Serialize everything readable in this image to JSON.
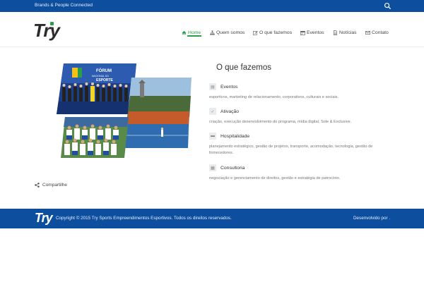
{
  "topbar": {
    "tagline": "Brands & People Connected",
    "search_icon": "search-icon"
  },
  "header": {
    "logo": "Try",
    "nav": [
      {
        "label": "Home",
        "icon": "home-icon",
        "active": true
      },
      {
        "label": "Quem somos",
        "icon": "sitemap-icon"
      },
      {
        "label": "O que fazemos",
        "icon": "edit-icon"
      },
      {
        "label": "Eventos",
        "icon": "calendar-icon"
      },
      {
        "label": "Notícias",
        "icon": "document-icon"
      },
      {
        "label": "Contato",
        "icon": "envelope-icon"
      }
    ]
  },
  "main": {
    "title": "O que fazemos",
    "services": [
      {
        "title": "Eventos",
        "icon": "table-icon",
        "desc": "esportivos, marketing de relacionamento, corporativos, culturais e sociais."
      },
      {
        "title": "Ativação",
        "icon": "check-icon",
        "desc": "criação, execução desenvolvimento do programa, mídia digital, Sole & Exclusive."
      },
      {
        "title": "Hospitalidade",
        "icon": "bed-icon",
        "desc": "planejamento estratégico, gestão de projetos, transporte, acomodação, tecnologia, gestão de fornecedores."
      },
      {
        "title": "Consultoria",
        "icon": "chart-icon",
        "desc": "negociação e gerenciamento de direitos, gestão e estratégia de patrocínio."
      }
    ],
    "collage_banner": "FÓRUM NACIONAL DO ESPORTE",
    "share_label": "Compartilhe"
  },
  "footer": {
    "logo": "Try",
    "copyright": "Copyright © 2015 Try Sports Empreendimentos Esportivos. Todos os direitos reservados.",
    "developer": "Desenvolvido por ."
  },
  "colors": {
    "primary": "#0d4f9e",
    "accent": "#2a9d4a"
  }
}
